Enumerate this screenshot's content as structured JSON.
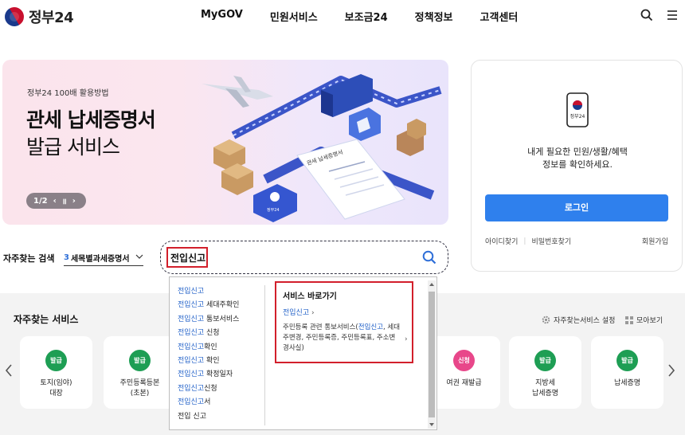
{
  "header": {
    "logo_text": "정부24",
    "nav": [
      "MyGOV",
      "민원서비스",
      "보조금24",
      "정책정보",
      "고객센터"
    ]
  },
  "banner": {
    "subtitle": "정부24 100배 활용방법",
    "title_line1": "관세 납세증명서",
    "title_line2": "발급 서비스",
    "pager": "1/2",
    "art_sign": "관세 납세증명서",
    "art_badge": "정부24"
  },
  "login": {
    "phone_label": "정부24",
    "message_line1": "내게 필요한 민원/생활/혜택",
    "message_line2": "정보를 확인하세요.",
    "login_button": "로그인",
    "find_id": "아이디찾기",
    "find_pw": "비밀번호찾기",
    "join": "회원가입"
  },
  "search": {
    "fav_label": "자주찾는 검색",
    "fav_select_num": "3",
    "fav_select_text": "세목별과세증명서",
    "query": "전입신고"
  },
  "dropdown": {
    "suggestions": [
      {
        "hl": "전입신고",
        "rest": ""
      },
      {
        "hl": "전입신고",
        "rest": " 세대주확인"
      },
      {
        "hl": "전입신고",
        "rest": " 통보서비스"
      },
      {
        "hl": "전입신고",
        "rest": " 신청"
      },
      {
        "hl": "전입신고",
        "rest": "확인"
      },
      {
        "hl": "전입신고",
        "rest": " 확인"
      },
      {
        "hl": "전입신고",
        "rest": " 확정일자"
      },
      {
        "hl": "전입신고",
        "rest": "신청"
      },
      {
        "hl": "전입신고",
        "rest": "서"
      },
      {
        "hl": "",
        "rest": "전입 신고"
      }
    ],
    "shortcut_title": "서비스 바로가기",
    "shortcut_link": "전입신고",
    "shortcut_desc_pre": "주민등록 관련 통보서비스(",
    "shortcut_desc_hl": "전입신고",
    "shortcut_desc_post": ", 세대주변경, 주민등록증, 주민등록표, 주소변경사실)"
  },
  "frequent": {
    "title": "자주찾는 서비스",
    "setting": "자주찾는서비스 설정",
    "view_all": "모아보기",
    "cards": [
      {
        "badge": "발급",
        "color": "#1e9e54",
        "name1": "토지(임야)",
        "name2": "대장"
      },
      {
        "badge": "발급",
        "color": "#1e9e54",
        "name1": "주민등록등본",
        "name2": "(초본)"
      },
      {
        "badge": "신청",
        "color": "#e8478a",
        "name1": "여권 재발급",
        "name2": ""
      },
      {
        "badge": "발급",
        "color": "#1e9e54",
        "name1": "지방세",
        "name2": "납세증명"
      },
      {
        "badge": "발급",
        "color": "#1e9e54",
        "name1": "납세증명",
        "name2": ""
      }
    ]
  }
}
